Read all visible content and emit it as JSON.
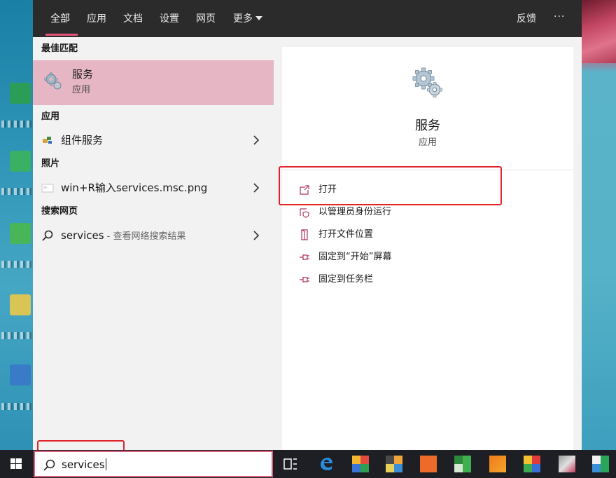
{
  "top_tabs": [
    {
      "label": "全部",
      "active": true
    },
    {
      "label": "应用"
    },
    {
      "label": "文档"
    },
    {
      "label": "设置"
    },
    {
      "label": "网页"
    },
    {
      "label": "更多"
    }
  ],
  "top_right": {
    "feedback": "反馈",
    "more": "···"
  },
  "results": {
    "best_match_header": "最佳匹配",
    "best_match": {
      "title": "服务",
      "subtitle": "应用",
      "icon": "gear-services-icon"
    },
    "apps_header": "应用",
    "apps": [
      {
        "label": "组件服务",
        "icon": "component-services-icon"
      }
    ],
    "photos_header": "照片",
    "photos": [
      {
        "label": "win+R输入services.msc.png",
        "icon": "image-icon"
      }
    ],
    "web_header": "搜索网页",
    "web": [
      {
        "label": "services",
        "suffix": " - 查看网络搜索结果",
        "icon": "search-icon"
      }
    ]
  },
  "detail": {
    "title": "服务",
    "subtitle": "应用",
    "actions": [
      {
        "label": "打开",
        "icon": "open-icon"
      },
      {
        "label": "以管理员身份运行",
        "icon": "shield-icon"
      },
      {
        "label": "打开文件位置",
        "icon": "file-location-icon"
      },
      {
        "label": "固定到“开始”屏幕",
        "icon": "pin-icon"
      },
      {
        "label": "固定到任务栏",
        "icon": "pin-icon"
      }
    ]
  },
  "taskbar": {
    "search_value": "services",
    "icons": [
      "task-view-icon",
      "edge-icon",
      "app-icon",
      "app-icon",
      "app-icon",
      "app-icon",
      "app-icon",
      "app-icon",
      "app-icon",
      "app-icon"
    ]
  },
  "colors": {
    "accent": "#e3557a",
    "selected_bg": "#e6b6c5",
    "topbar_bg": "#2b2b2b",
    "annotation": "#e0242a",
    "icon_pink": "#b0355d"
  }
}
